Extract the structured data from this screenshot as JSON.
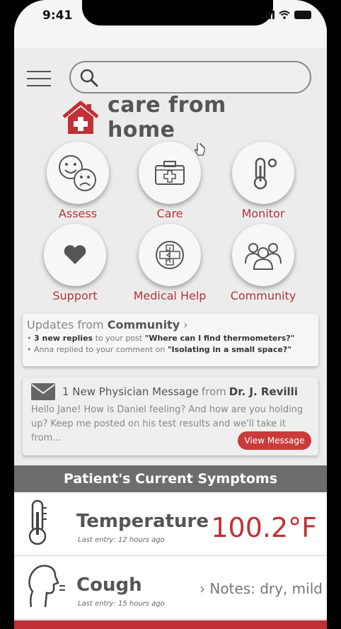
{
  "status_bar": {
    "time": "9:41"
  },
  "search": {
    "placeholder": ""
  },
  "brand": {
    "title": "care from home"
  },
  "tiles": [
    {
      "label": "Assess"
    },
    {
      "label": "Care"
    },
    {
      "label": "Monitor"
    },
    {
      "label": "Support"
    },
    {
      "label": "Medical Help"
    },
    {
      "label": "Community"
    }
  ],
  "updates": {
    "prefix": "Updates from",
    "source": "Community",
    "chevron": "›",
    "items": [
      {
        "bullet": "•",
        "bold": "3 new replies",
        "text": " to your post ",
        "quote": "\"Where can I find thermometers?\""
      },
      {
        "bullet": "•",
        "text": "Anna replied to your comment on ",
        "quote": "\"Isolating in a small space?\""
      }
    ]
  },
  "message": {
    "count_text": "1 New Physician Message",
    "from_word": "from",
    "sender": "Dr. J. Revilli",
    "preview": "Hello Jane! How is Daniel feeling? And how are you holding up? Keep me posted on his test results and we'll take it from...",
    "button_label": "View Message"
  },
  "symptoms": {
    "header": "Patient's Current Symptoms",
    "rows": [
      {
        "name": "Temperature",
        "last_entry": "Last entry: 12 hours ago",
        "value": "100.2",
        "unit": "°F"
      },
      {
        "name": "Cough",
        "last_entry": "Last entry: 15 hours ago",
        "note": "› Notes: dry, mild"
      }
    ]
  },
  "colors": {
    "accent": "#c03035",
    "header_gray": "#6d6d6d",
    "background": "#ececec"
  }
}
